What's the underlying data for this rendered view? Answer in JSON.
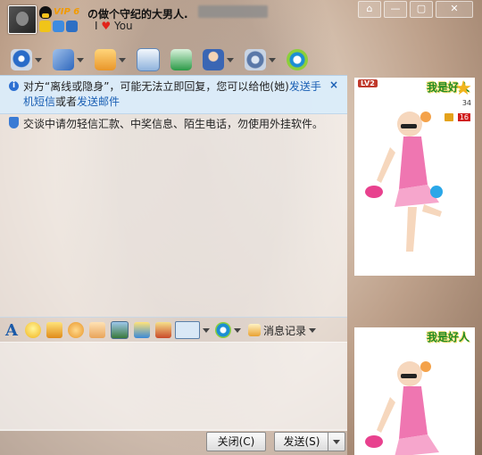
{
  "titlebar": {
    "vip_label": "VIP 6",
    "contact_name": "の做个守纪的大男人.",
    "signature_prefix": "I",
    "signature_heart": "♥",
    "signature_suffix": "You",
    "window_buttons": {
      "skin": "⌂",
      "minimize": "—",
      "maximize": "▢",
      "close": "✕"
    }
  },
  "toolbar": {
    "items": [
      {
        "name": "video-call",
        "color": "#2a6cc8"
      },
      {
        "name": "voice-call",
        "color": "#3c7bd6"
      },
      {
        "name": "file-transfer",
        "color": "#e9962a"
      },
      {
        "name": "send-sms",
        "color": "#2e78c9"
      },
      {
        "name": "create-group",
        "color": "#2b9a47"
      },
      {
        "name": "remote-assist",
        "color": "#3a66b4"
      },
      {
        "name": "app-settings",
        "color": "#5a78a8"
      },
      {
        "name": "soso",
        "color": "#1b8ed4"
      }
    ]
  },
  "notices": {
    "offline_prefix": "对方“离线或隐身”，可能无法立即回复，您可以给他(她)",
    "offline_link1": "发送手机短信",
    "offline_mid": "或者",
    "offline_link2": "发送邮件",
    "close_symbol": "×",
    "security": "交谈中请勿轻信汇款、中奖信息、陌生电话，勿使用外挂软件。"
  },
  "format_bar": {
    "font_label": "A",
    "history_label": "消息记录"
  },
  "footer": {
    "close_label": "关闭(C)",
    "send_label": "发送(S)"
  },
  "side_panel": {
    "my_show_name": "我是好人",
    "peer_show_name": "我是好人",
    "level": "LV2",
    "count_a": "34",
    "count_b": "16"
  }
}
